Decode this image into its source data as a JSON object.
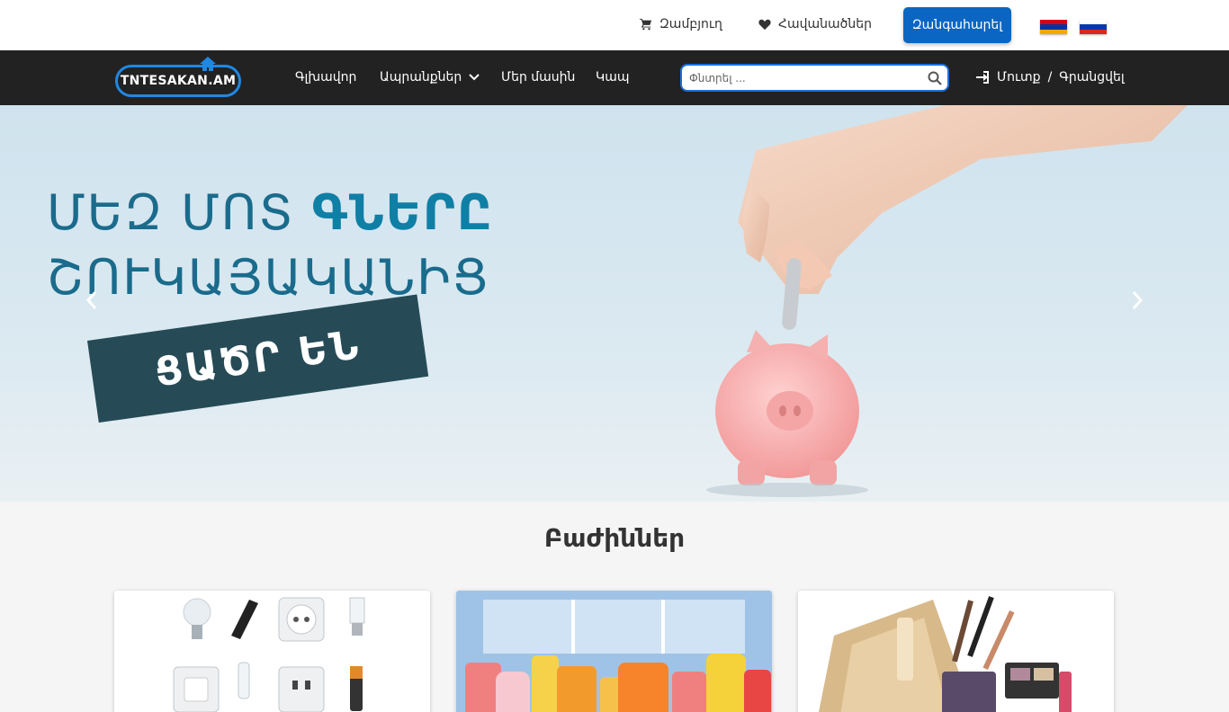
{
  "topbar": {
    "cart_label": "Զամբյուղ",
    "favorites_label": "Հավանածներ",
    "call_button": "Զանգահարել",
    "languages": [
      "hy",
      "ru"
    ]
  },
  "navbar": {
    "logo_text": "TNTESAKAN.AM",
    "items": [
      {
        "label": "Գլխավոր"
      },
      {
        "label": "Ապրանքներ"
      },
      {
        "label": "Մեր մասին"
      },
      {
        "label": "Կապ"
      }
    ],
    "search_placeholder": "Փնտրել ...",
    "login_label": "Մուտք",
    "login_separator": "/",
    "register_label": "Գրանցվել"
  },
  "hero": {
    "line1_plain": "ՄԵԶ ՄՈՏ ",
    "line1_bold": "ԳՆԵՐԸ",
    "line2": "ՇՈՒԿԱՅԱԿԱՆԻՑ",
    "banner": "ՑԱԾՐ ԵՆ"
  },
  "sections": {
    "title": "Բաժիններ"
  },
  "colors": {
    "accent": "#0a66c2",
    "navbar": "#222222",
    "hero_text": "#1a6b8c",
    "banner": "#264b56"
  },
  "icons": [
    "cart-icon",
    "heart-icon",
    "house-icon",
    "chevron-down-icon",
    "search-icon",
    "sign-in-icon",
    "chevron-left-icon",
    "chevron-right-icon"
  ]
}
